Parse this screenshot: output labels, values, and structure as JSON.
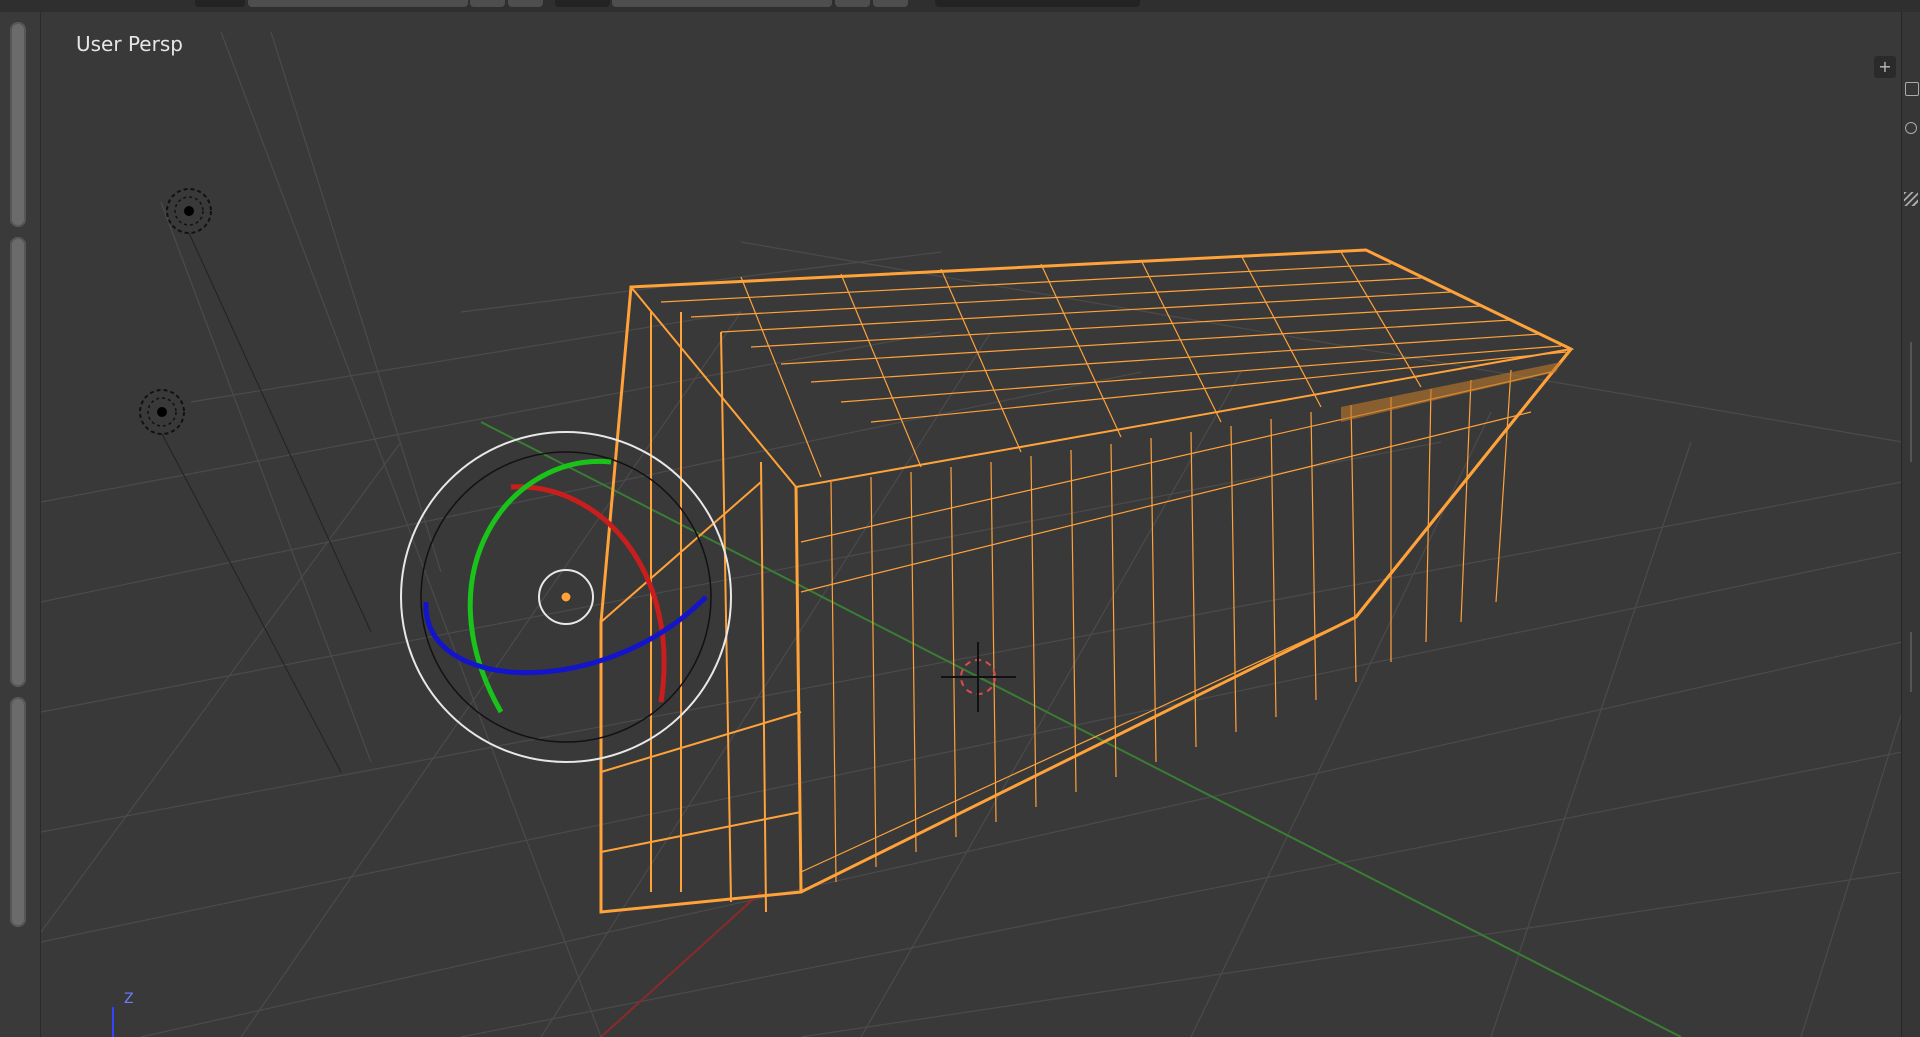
{
  "viewport": {
    "label": "User Persp",
    "axis_label_z": "Z"
  },
  "header": {
    "add_button_label": "+"
  },
  "colors": {
    "background": "#393939",
    "grid": "#4a4a4a",
    "selection": "#ffa23a",
    "x_axis": "#c03030",
    "y_axis": "#2ea83a",
    "z_axis": "#3443ff"
  },
  "icons": [
    "light-icon",
    "light-icon",
    "rotate-gizmo-icon",
    "3d-cursor-icon",
    "plus-icon"
  ]
}
